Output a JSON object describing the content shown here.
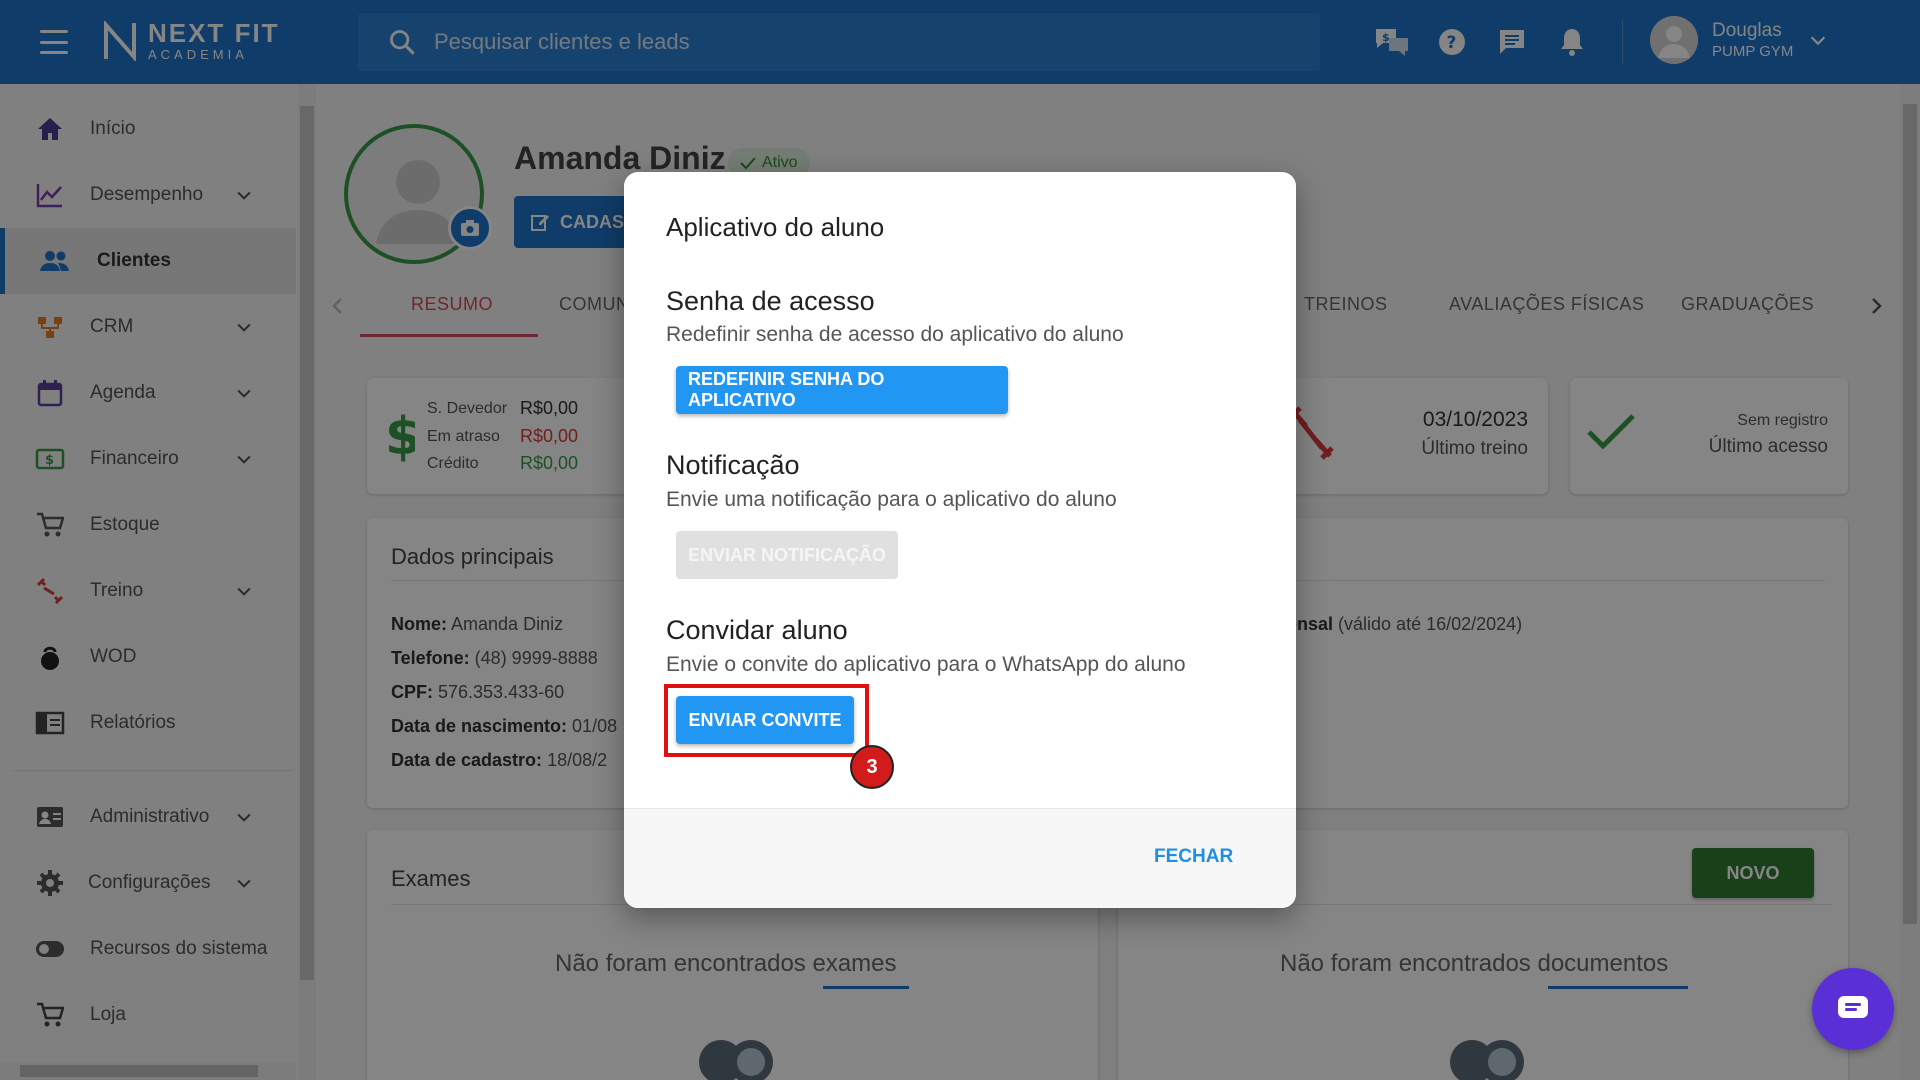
{
  "topbar": {
    "logo_line1": "NEXT FIT",
    "logo_line2": "ACADEMIA",
    "search_placeholder": "Pesquisar clientes e leads",
    "user_name": "Douglas",
    "user_gym": "PUMP GYM"
  },
  "sidebar": {
    "items": [
      {
        "label": "Início",
        "icon": "home-icon"
      },
      {
        "label": "Desempenho",
        "icon": "chart-line-icon"
      },
      {
        "label": "Clientes",
        "icon": "people-icon"
      },
      {
        "label": "CRM",
        "icon": "crm-icon"
      },
      {
        "label": "Agenda",
        "icon": "calendar-icon"
      },
      {
        "label": "Financeiro",
        "icon": "money-icon"
      },
      {
        "label": "Estoque",
        "icon": "cart-icon"
      },
      {
        "label": "Treino",
        "icon": "dumbbell-icon"
      },
      {
        "label": "WOD",
        "icon": "kettlebell-icon"
      },
      {
        "label": "Relatórios",
        "icon": "report-icon"
      },
      {
        "label": "Administrativo",
        "icon": "id-card-icon"
      },
      {
        "label": "Configurações",
        "icon": "gear-icon"
      },
      {
        "label": "Recursos do sistema",
        "icon": "toggle-icon"
      },
      {
        "label": "Loja",
        "icon": "cart-icon"
      }
    ]
  },
  "client": {
    "name": "Amanda Diniz",
    "status": "Ativo",
    "cadastro_button": "CADAS"
  },
  "tabs": [
    "RESUMO",
    "COMUN",
    "TREINOS",
    "AVALIAÇÕES FÍSICAS",
    "GRADUAÇÕES"
  ],
  "finance": {
    "devedor_label": "S. Devedor",
    "devedor_value": "R$0,00",
    "atraso_label": "Em atraso",
    "atraso_value": "R$0,00",
    "credito_label": "Crédito",
    "credito_value": "R$0,00"
  },
  "training_card": {
    "date": "03/10/2023",
    "label": "Último treino"
  },
  "access_card": {
    "value": "Sem registro",
    "label": "Último acesso"
  },
  "dados": {
    "title": "Dados principais",
    "lines": [
      {
        "key": "Nome:",
        "value": " Amanda Diniz"
      },
      {
        "key": "Telefone:",
        "value": " (48) 9999-8888"
      },
      {
        "key": "CPF:",
        "value": " 576.353.433-60"
      },
      {
        "key": "Data de nascimento:",
        "value": " 01/08"
      },
      {
        "key": "Data de cadastro:",
        "value": " 18/08/2"
      }
    ],
    "plan_bold": "ensal",
    "plan_rest": " (válido até 16/02/2024)"
  },
  "exames": {
    "title": "Exames",
    "empty": "Não foram encontrados exames"
  },
  "documentos": {
    "empty": "Não foram encontrados documentos",
    "novo_button": "NOVO"
  },
  "dialog": {
    "title": "Aplicativo do aluno",
    "senha_heading": "Senha de acesso",
    "senha_desc": "Redefinir senha de acesso do aplicativo do aluno",
    "senha_button": "REDEFINIR SENHA DO APLICATIVO",
    "notif_heading": "Notificação",
    "notif_desc": "Envie uma notificação para o aplicativo do aluno",
    "notif_button": "ENVIAR NOTIFICAÇÃO",
    "convite_heading": "Convidar aluno",
    "convite_desc": "Envie o convite do aplicativo para o WhatsApp do aluno",
    "convite_button": "ENVIAR CONVITE",
    "close_button": "FECHAR"
  },
  "annotation": {
    "step": "3"
  },
  "colors": {
    "primary": "#1f74c9",
    "accent_blue": "#2196f3",
    "danger": "#d21b1b",
    "success": "#2e7d32",
    "tab_active": "#d64a5c"
  }
}
